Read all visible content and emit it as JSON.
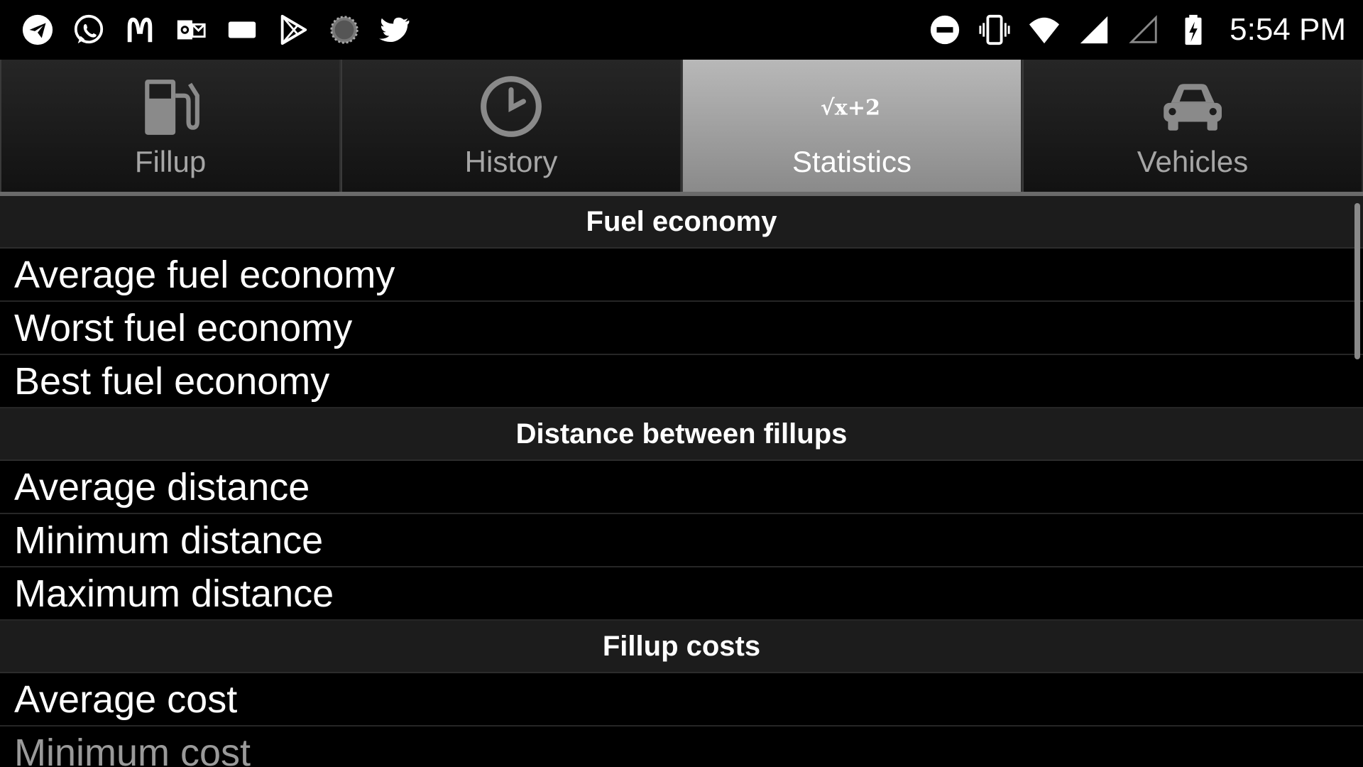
{
  "status_bar": {
    "left_icons": [
      "telegram-icon",
      "whatsapp-icon",
      "mcdonalds-icon",
      "outlook-icon",
      "message-icon",
      "play-store-icon",
      "spinner-icon",
      "twitter-icon"
    ],
    "right_icons": [
      "do-not-disturb-icon",
      "vibrate-icon",
      "wifi-icon",
      "cell-signal-icon",
      "cell-signal-empty-icon",
      "battery-charging-icon"
    ],
    "time": "5:54 PM"
  },
  "tabs": [
    {
      "label": "Fillup",
      "icon": "fuel-pump-icon",
      "active": false
    },
    {
      "label": "History",
      "icon": "clock-icon",
      "active": false
    },
    {
      "label": "Statistics",
      "icon": "sqrt-formula-icon",
      "active": true,
      "icon_text": "√x+2"
    },
    {
      "label": "Vehicles",
      "icon": "car-icon",
      "active": false
    }
  ],
  "sections": [
    {
      "title": "Fuel economy",
      "rows": [
        "Average fuel economy",
        "Worst fuel economy",
        "Best fuel economy"
      ]
    },
    {
      "title": "Distance between fillups",
      "rows": [
        "Average distance",
        "Minimum distance",
        "Maximum distance"
      ]
    },
    {
      "title": "Fillup costs",
      "rows": [
        "Average cost",
        "Minimum cost"
      ]
    }
  ]
}
